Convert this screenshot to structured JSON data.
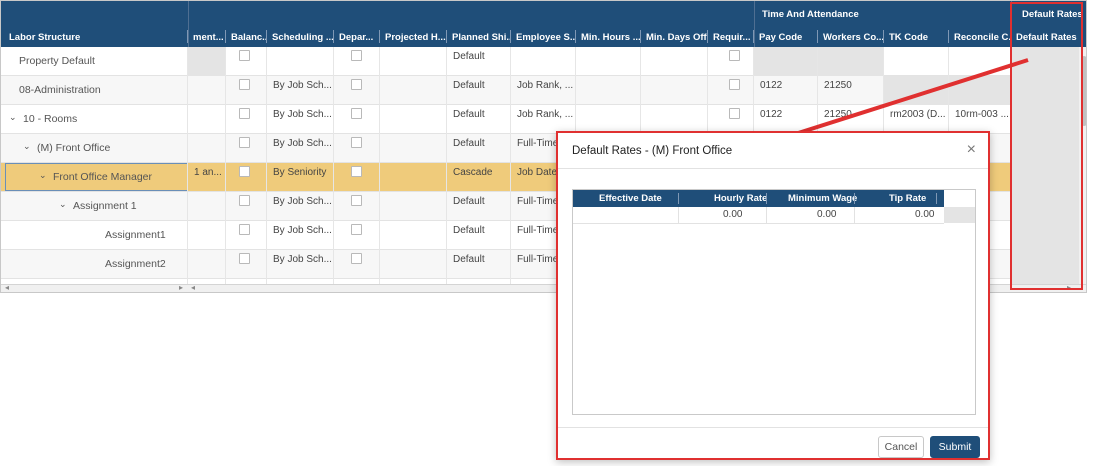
{
  "grid": {
    "groups": {
      "time_attendance": "Time And Attendance",
      "default_rates": "Default Rates"
    },
    "columns": [
      "Labor Structure",
      "ment...",
      "Balanc...",
      "Scheduling ...",
      "Depar...",
      "Projected H...",
      "Planned Shi...",
      "Employee S...",
      "Min. Hours ...",
      "Min. Days Off",
      "Requir...",
      "Pay Code",
      "Workers Co...",
      "TK Code",
      "Reconcile C...",
      "Default Rates"
    ],
    "rows": [
      {
        "label": "Property Default",
        "col1": "",
        "sched": "",
        "planned": "Default",
        "emp": "",
        "pay": "",
        "workers": "",
        "tk": "",
        "rec": ""
      },
      {
        "label": "08-Administration",
        "col1": "",
        "sched": "By Job Sch...",
        "planned": "Default",
        "emp": "Job Rank, ...",
        "pay": "0122",
        "workers": "21250",
        "tk": "",
        "rec": ""
      },
      {
        "label": "10 - Rooms",
        "col1": "",
        "sched": "By Job Sch...",
        "planned": "Default",
        "emp": "Job Rank, ...",
        "pay": "0122",
        "workers": "21250",
        "tk": "rm2003 (D...",
        "rec": "10rm-003 ..."
      },
      {
        "label": "(M) Front Office",
        "col1": "",
        "sched": "By Job Sch...",
        "planned": "Default",
        "emp": "Full-Time",
        "pay": "",
        "workers": "",
        "tk": "",
        "rec": ""
      },
      {
        "label": "Front Office Manager",
        "col1": "1 an...",
        "sched": "By Seniority",
        "planned": "Cascade",
        "emp": "Job Date,...",
        "pay": "",
        "workers": "",
        "tk": "",
        "rec": ""
      },
      {
        "label": "Assignment 1",
        "col1": "",
        "sched": "By Job Sch...",
        "planned": "Default",
        "emp": "Full-Time",
        "pay": "",
        "workers": "",
        "tk": "",
        "rec": ""
      },
      {
        "label": "Assignment1",
        "col1": "",
        "sched": "By Job Sch...",
        "planned": "Default",
        "emp": "Full-Time",
        "pay": "",
        "workers": "",
        "tk": "",
        "rec": ""
      },
      {
        "label": "Assignment2",
        "col1": "",
        "sched": "By Job Sch...",
        "planned": "Default",
        "emp": "Full-Time",
        "pay": "",
        "workers": "",
        "tk": "",
        "rec": ""
      }
    ]
  },
  "modal": {
    "title": "Default Rates - (M) Front Office",
    "close_glyph": "×",
    "columns": [
      "Effective Date",
      "Hourly Rate",
      "Minimum Wage",
      "Tip Rate"
    ],
    "row": {
      "effective_date": "",
      "hourly_rate": "0.00",
      "minimum_wage": "0.00",
      "tip_rate": "0.00"
    },
    "cancel_label": "Cancel",
    "submit_label": "Submit"
  },
  "icons": {
    "expand": "chevron-down-icon",
    "close": "close-icon"
  },
  "colors": {
    "header": "#1f4e79",
    "selected_row": "#efcb7b",
    "annotation": "#e03030"
  }
}
